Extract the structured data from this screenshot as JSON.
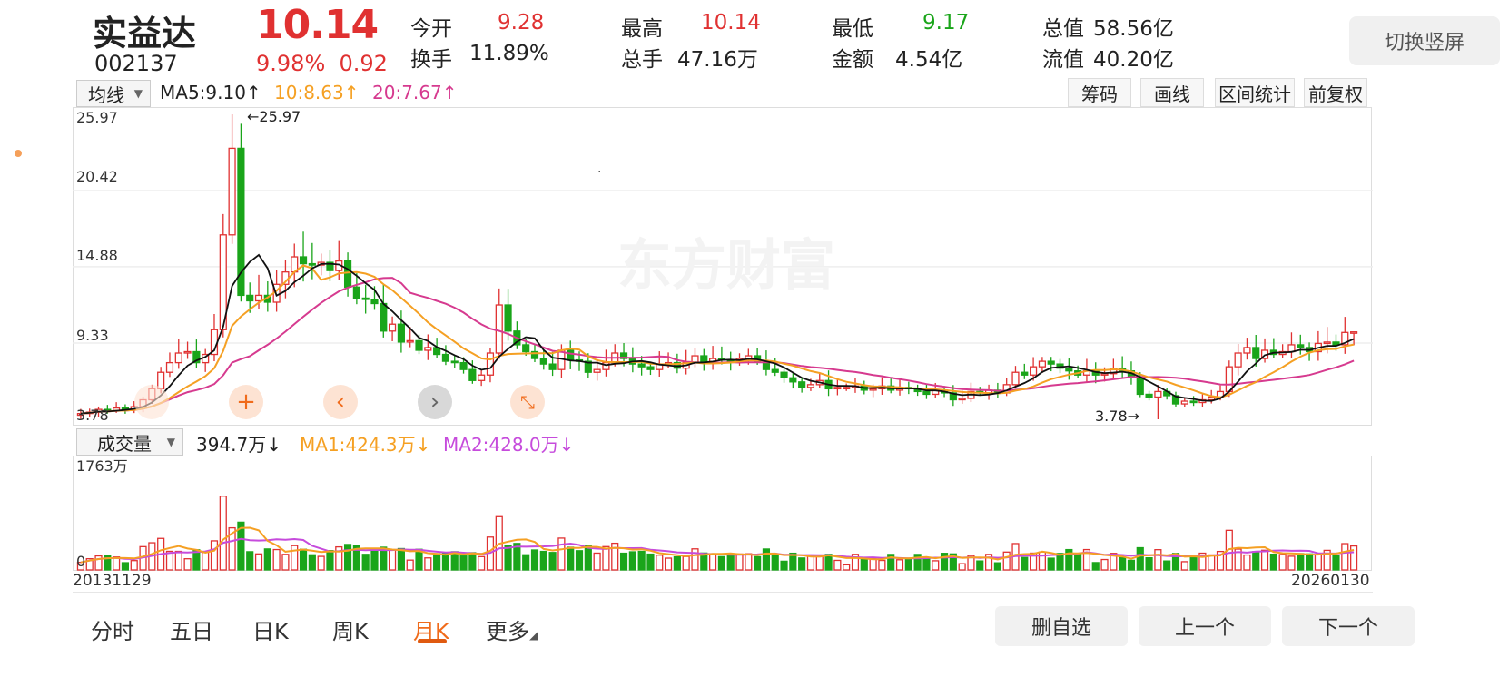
{
  "stock": {
    "name": "实益达",
    "code": "002137",
    "price": "10.14",
    "change_pct": "9.98%",
    "change_abs": "0.92"
  },
  "quotes": {
    "open_label": "今开",
    "open": "9.28",
    "high_label": "最高",
    "high": "10.14",
    "low_label": "最低",
    "low": "9.17",
    "total_value_label": "总值",
    "total_value": "58.56亿",
    "turnover_label": "换手",
    "turnover": "11.89%",
    "volume_label": "总手",
    "volume": "47.16万",
    "amount_label": "金额",
    "amount": "4.54亿",
    "float_value_label": "流值",
    "float_value": "40.20亿"
  },
  "portrait_button": "切换竖屏",
  "ma_selector": "均线",
  "ma_legend": {
    "ma5": "MA5:9.10↑",
    "ma10": "10:8.63↑",
    "ma20": "20:7.67↑"
  },
  "tools": [
    "筹码",
    "画线",
    "区间统计",
    "前复权"
  ],
  "price_axis": [
    "25.97",
    "20.42",
    "14.88",
    "9.33",
    "3.78"
  ],
  "max_marker": "←25.97",
  "min_marker": "3.78→",
  "watermark": "东方财富",
  "volume_selector": "成交量",
  "vol_legend": {
    "vol": "394.7万↓",
    "ma1": "MA1:424.3万↓",
    "ma2": "MA2:428.0万↓"
  },
  "vol_axis": {
    "max": "1763万",
    "min": "0"
  },
  "date_start": "20131129",
  "date_end": "20260130",
  "nav_controls": {
    "zoom_in": "+",
    "prev": "‹",
    "next": "›",
    "collapse": "⤡"
  },
  "bottom_tabs": [
    "分时",
    "五日",
    "日K",
    "周K",
    "月K",
    "更多"
  ],
  "actions": {
    "remove": "删自选",
    "prev": "上一个",
    "next": "下一个"
  },
  "colors": {
    "up": "#e03131",
    "down": "#1aa51a",
    "ma5": "#111111",
    "ma10": "#f5a023",
    "ma20": "#d63a8f",
    "accent": "#f06b1b"
  },
  "chart_data": {
    "type": "candlestick",
    "period": "monthly",
    "x_range": [
      "20131129",
      "20260130"
    ],
    "price_ylim": [
      3.78,
      25.97
    ],
    "price_max_label": 25.97,
    "price_min_label": 3.78,
    "ma_last": {
      "MA5": 9.1,
      "MA10": 8.63,
      "MA20": 7.67
    },
    "volume_ylim": [
      0,
      1763
    ],
    "volume_unit": "万",
    "volume_last": 394.7,
    "volume_ma_last": {
      "MA1": 424.3,
      "MA2": 428.0
    },
    "closes": [
      4.2,
      4.3,
      4.5,
      4.4,
      4.6,
      4.5,
      4.7,
      5.2,
      6.0,
      7.2,
      7.9,
      8.6,
      8.7,
      7.9,
      8.5,
      10.3,
      17.2,
      23.5,
      12.8,
      12.4,
      12.8,
      12.3,
      13.6,
      14.5,
      15.6,
      15.1,
      15.0,
      15.2,
      14.6,
      15.3,
      13.4,
      12.6,
      12.5,
      12.2,
      10.2,
      10.7,
      9.4,
      9.5,
      8.8,
      9.0,
      8.5,
      8.0,
      7.9,
      7.4,
      6.6,
      7.0,
      8.6,
      12.1,
      10.2,
      9.2,
      8.7,
      8.2,
      7.8,
      7.4,
      8.8,
      8.1,
      8.0,
      7.2,
      7.4,
      7.9,
      8.6,
      8.2,
      7.8,
      7.6,
      7.4,
      7.8,
      7.9,
      7.5,
      7.9,
      8.4,
      7.9,
      8.2,
      8.1,
      8.0,
      8.2,
      8.4,
      8.0,
      7.4,
      7.2,
      6.8,
      6.5,
      6.1,
      6.3,
      6.6,
      6.0,
      6.1,
      6.1,
      6.2,
      5.9,
      6.0,
      6.2,
      5.9,
      6.1,
      6.0,
      5.8,
      5.6,
      5.9,
      5.7,
      5.2,
      5.3,
      5.8,
      5.7,
      5.9,
      5.7,
      6.3,
      7.2,
      7.0,
      7.6,
      8.0,
      7.8,
      7.5,
      7.3,
      7.0,
      7.3,
      7.0,
      7.1,
      7.5,
      7.3,
      6.8,
      5.6,
      5.4,
      5.8,
      5.5,
      4.9,
      5.1,
      5.0,
      5.2,
      5.4,
      5.8,
      7.6,
      8.6,
      9.0,
      8.2,
      8.8,
      8.5,
      8.7,
      9.2,
      9.0,
      8.7,
      9.3,
      9.4,
      9.2,
      10.1,
      10.14
    ]
  }
}
